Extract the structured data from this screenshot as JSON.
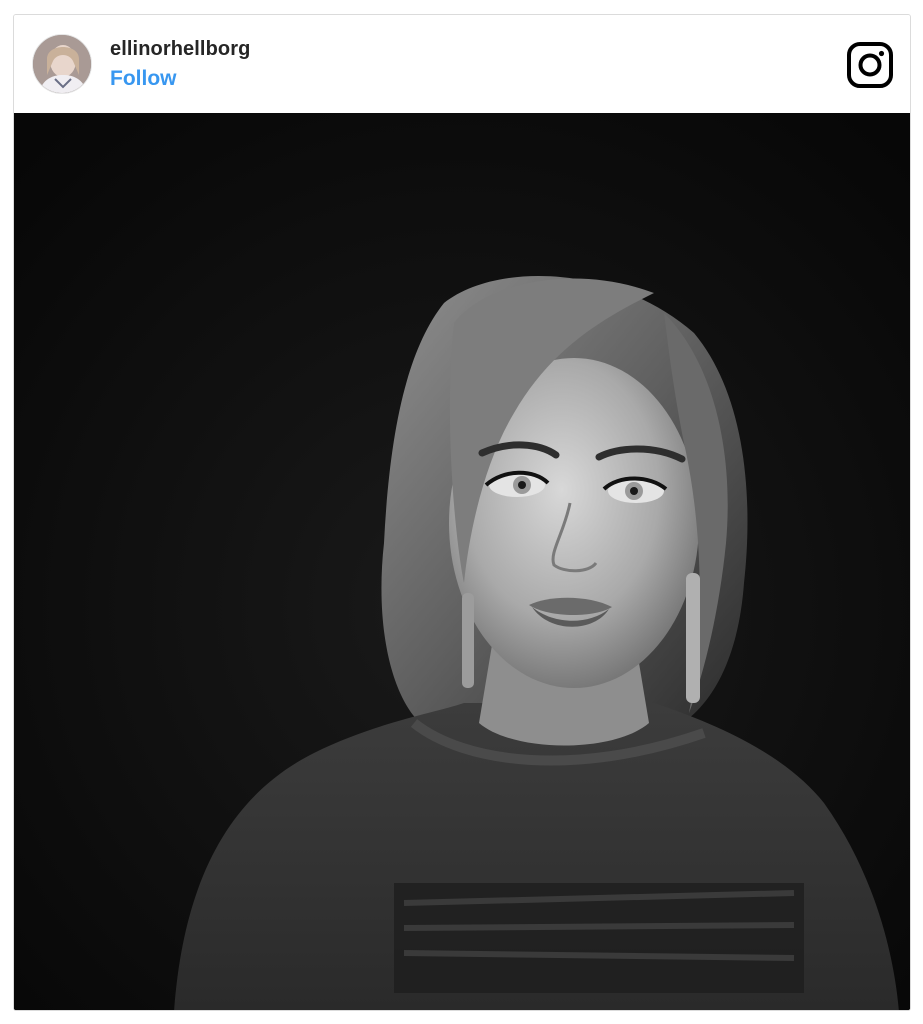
{
  "post": {
    "username": "ellinorhellborg",
    "follow_label": "Follow",
    "instagram_icon": "instagram-logo-icon",
    "avatar_icon": "profile-avatar",
    "photo_description_icon": "post-photo"
  },
  "colors": {
    "follow": "#3897f0",
    "username": "#262626",
    "border": "#dbdbdb",
    "photo_background": "#0b0b0b"
  }
}
